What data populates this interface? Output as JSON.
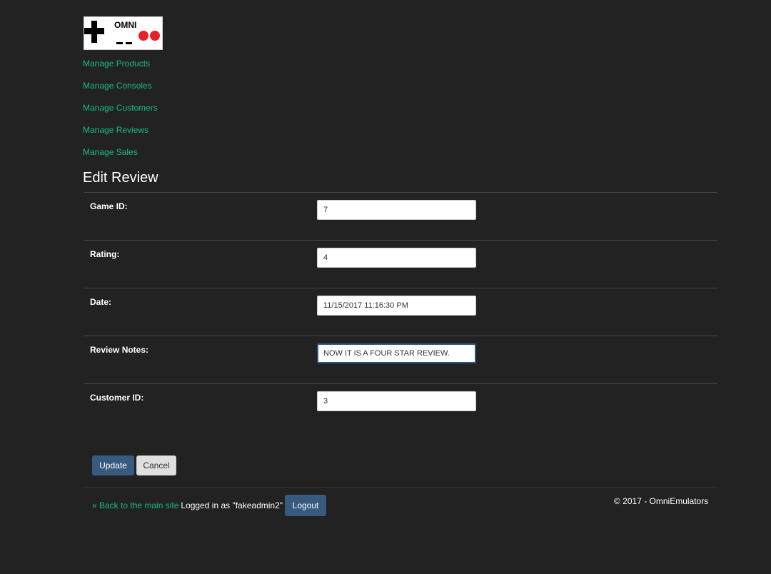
{
  "logo": {
    "text": "OMNI"
  },
  "nav": {
    "items": [
      {
        "label": "Manage Products"
      },
      {
        "label": "Manage Consoles"
      },
      {
        "label": "Manage Customers"
      },
      {
        "label": "Manage Reviews"
      },
      {
        "label": "Manage Sales"
      }
    ]
  },
  "page": {
    "title": "Edit Review"
  },
  "form": {
    "fields": [
      {
        "label": "Game ID:",
        "value": "7"
      },
      {
        "label": "Rating:",
        "value": "4"
      },
      {
        "label": "Date:",
        "value": "11/15/2017 11:16:30 PM"
      },
      {
        "label": "Review Notes:",
        "value": "NOW IT IS A FOUR STAR REVIEW."
      },
      {
        "label": "Customer ID:",
        "value": "3"
      }
    ],
    "update_label": "Update",
    "cancel_label": "Cancel"
  },
  "footer": {
    "back_link": "« Back to the main site",
    "logged_in_text": "Logged in as \"fakeadmin2\"",
    "logout_label": "Logout",
    "copyright": "© 2017 - OmniEmulators"
  },
  "colors": {
    "background": "#222222",
    "link": "#18b98a",
    "primary_button": "#375a7f",
    "logo_red": "#e8202a"
  },
  "icons": [
    "dpad-icon",
    "button-red-icon"
  ]
}
